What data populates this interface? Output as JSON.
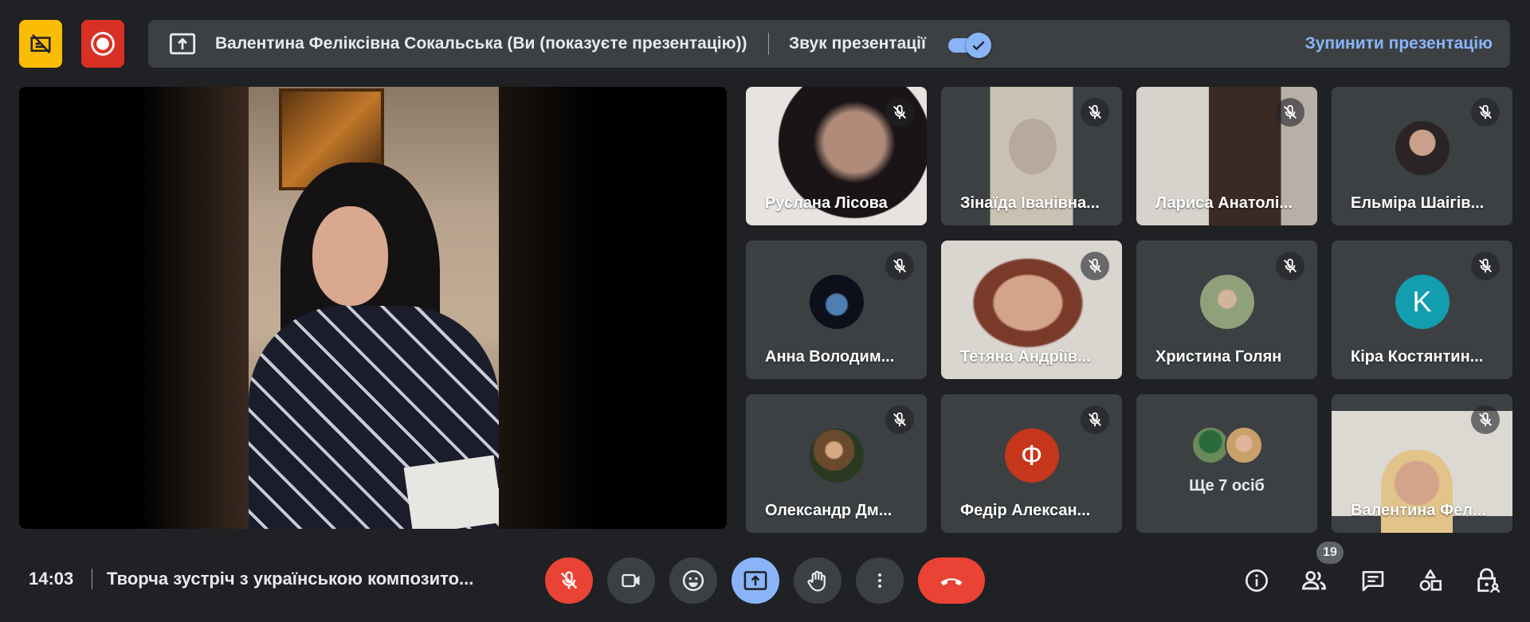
{
  "presentation_banner": {
    "presenter_text": "Валентина Феліксівна Сокальська (Ви (показуєте презентацію))",
    "audio_label": "Звук презентації",
    "audio_enabled": true,
    "stop_label": "Зупинити презентацію"
  },
  "participants": [
    {
      "name": "Руслана Лісова"
    },
    {
      "name": "Зінаїда Іванівна..."
    },
    {
      "name": "Лариса Анатолі..."
    },
    {
      "name": "Ельміра Шаігів..."
    },
    {
      "name": "Анна Володим..."
    },
    {
      "name": "Тетяна Андріїв..."
    },
    {
      "name": "Христина Голян"
    },
    {
      "name": "Кіра Костянтин...",
      "initial": "K"
    },
    {
      "name": "Олександр Дм..."
    },
    {
      "name": "Федір Алексан...",
      "initial": "Ф"
    },
    {
      "more_label": "Ще 7 осіб"
    },
    {
      "name": "Валентина Фел..."
    }
  ],
  "bottom_bar": {
    "time": "14:03",
    "meeting_title": "Творча зустріч з українською композито...",
    "participant_count": "19"
  },
  "colors": {
    "background": "#202124",
    "tile": "#3c4043",
    "accent_blue": "#8ab4f8",
    "end_call_red": "#ea4335",
    "avatar_teal": "#129eaf",
    "avatar_orange": "#c5361b"
  }
}
